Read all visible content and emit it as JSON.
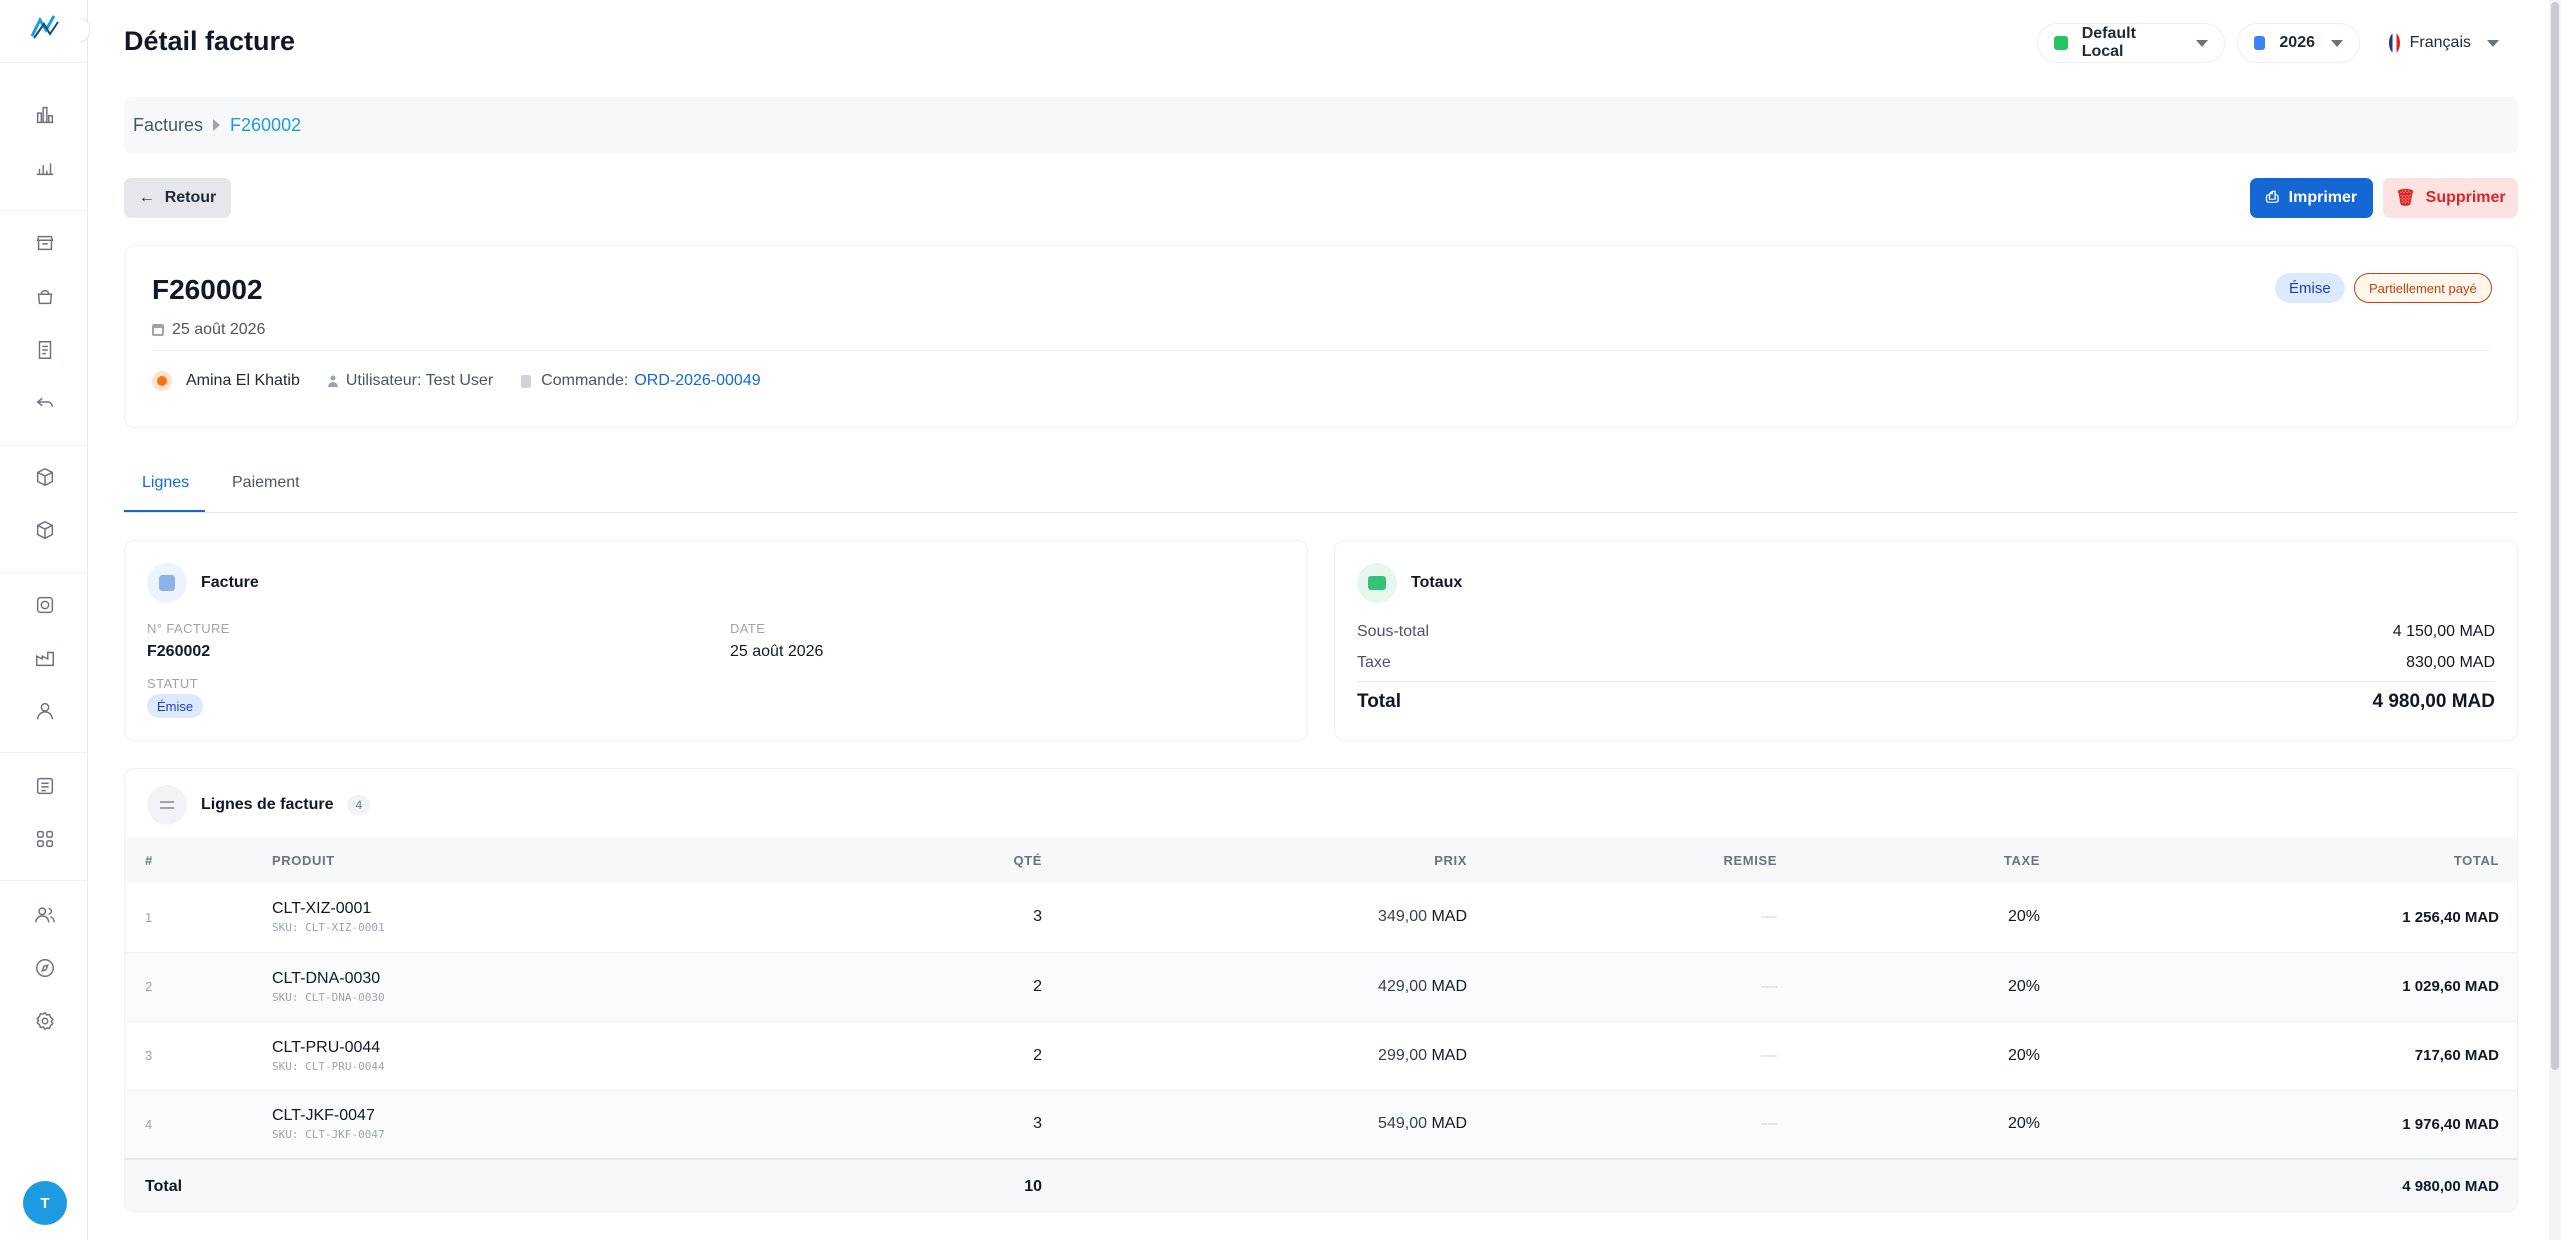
{
  "header": {
    "title": "Détail facture",
    "warehouse": "Default Local",
    "year": "2026",
    "language": "Français"
  },
  "breadcrumb": {
    "root": "Factures",
    "current": "F260002"
  },
  "actions": {
    "back": "Retour",
    "print": "Imprimer",
    "delete": "Supprimer"
  },
  "invoice": {
    "number": "F260002",
    "date": "25 août 2026",
    "status_badge": "Émise",
    "payment_badge": "Partiellement payé",
    "client": "Amina El Khatib",
    "user": "Utilisateur: Test User",
    "order_label": "Commande:",
    "order_ref": "ORD-2026-00049"
  },
  "tabs": [
    "Lignes",
    "Paiement"
  ],
  "facture_card": {
    "title": "Facture",
    "num_label": "N° facture",
    "num_value": "F260002",
    "date_label": "Date",
    "date_value": "25 août 2026",
    "status_label": "Statut",
    "status_value": "Émise"
  },
  "totals_card": {
    "title": "Totaux",
    "subtotal_label": "Sous-total",
    "subtotal_value": "4 150,00 MAD",
    "tax_label": "Taxe",
    "tax_value": "830,00 MAD",
    "total_label": "Total",
    "total_value": "4 980,00 MAD"
  },
  "lines": {
    "title": "Lignes de facture",
    "count": "4",
    "columns": [
      "#",
      "Produit",
      "Qté",
      "Prix",
      "Remise",
      "Taxe",
      "Total"
    ],
    "rows": [
      {
        "n": "1",
        "name": "CLT-XIZ-0001",
        "sku": "SKU: CLT-XIZ-0001",
        "qty": "3",
        "price": "349,00",
        "currency": "MAD",
        "discount": "—",
        "tax": "20%",
        "total": "1 256,40 MAD"
      },
      {
        "n": "2",
        "name": "CLT-DNA-0030",
        "sku": "SKU: CLT-DNA-0030",
        "qty": "2",
        "price": "429,00",
        "currency": "MAD",
        "discount": "—",
        "tax": "20%",
        "total": "1 029,60 MAD"
      },
      {
        "n": "3",
        "name": "CLT-PRU-0044",
        "sku": "SKU: CLT-PRU-0044",
        "qty": "2",
        "price": "299,00",
        "currency": "MAD",
        "discount": "—",
        "tax": "20%",
        "total": "717,60 MAD"
      },
      {
        "n": "4",
        "name": "CLT-JKF-0047",
        "sku": "SKU: CLT-JKF-0047",
        "qty": "3",
        "price": "549,00",
        "currency": "MAD",
        "discount": "—",
        "tax": "20%",
        "total": "1 976,40 MAD"
      }
    ],
    "footer": {
      "label": "Total",
      "qty": "10",
      "total": "4 980,00 MAD"
    }
  },
  "user_avatar": "T",
  "colors": {
    "primary": "#1567d3",
    "accent": "#1e9be0",
    "danger": "#dc2626",
    "warning": "#c2410c"
  },
  "icons": {
    "sidebar": [
      "dashboard-icon",
      "chart-icon",
      "store-icon",
      "basket-icon",
      "document-icon",
      "return-icon",
      "box-icon",
      "package-icon",
      "target-icon",
      "factory-icon",
      "user-icon",
      "list-icon",
      "grid-icon",
      "users-icon",
      "compass-icon",
      "settings-icon"
    ]
  }
}
